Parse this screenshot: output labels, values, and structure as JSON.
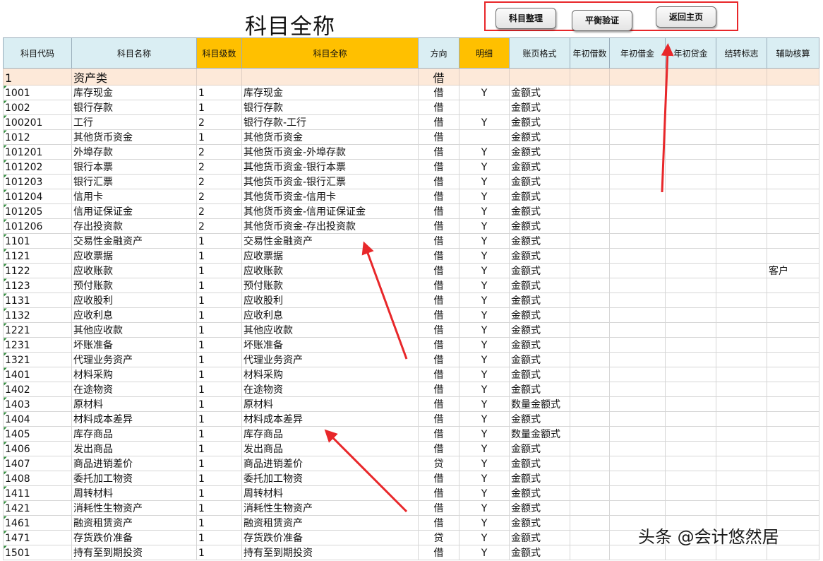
{
  "sheet_title": "科目全称",
  "buttons": [
    "科目整理",
    "平衡验证",
    "返回主页"
  ],
  "columns": [
    "科目代码",
    "科目名称",
    "科目级数",
    "科目全称",
    "方向",
    "明细",
    "账页格式",
    "年初借数",
    "年初借金",
    "年初贷金",
    "结转标志",
    "辅助核算"
  ],
  "group_row": [
    "1",
    "资产类",
    "",
    "",
    "借",
    "",
    "",
    "",
    "",
    "",
    "",
    ""
  ],
  "rows": [
    [
      "1001",
      "库存现金",
      "1",
      "库存现金",
      "借",
      "Y",
      "金额式",
      "",
      "",
      "",
      "",
      ""
    ],
    [
      "1002",
      "银行存款",
      "1",
      "银行存款",
      "借",
      "",
      "金额式",
      "",
      "",
      "",
      "",
      ""
    ],
    [
      "100201",
      "工行",
      "2",
      "银行存款-工行",
      "借",
      "Y",
      "金额式",
      "",
      "",
      "",
      "",
      ""
    ],
    [
      "1012",
      "其他货币资金",
      "1",
      "其他货币资金",
      "借",
      "",
      "金额式",
      "",
      "",
      "",
      "",
      ""
    ],
    [
      "101201",
      "外埠存款",
      "2",
      "其他货币资金-外埠存款",
      "借",
      "Y",
      "金额式",
      "",
      "",
      "",
      "",
      ""
    ],
    [
      "101202",
      "银行本票",
      "2",
      "其他货币资金-银行本票",
      "借",
      "Y",
      "金额式",
      "",
      "",
      "",
      "",
      ""
    ],
    [
      "101203",
      "银行汇票",
      "2",
      "其他货币资金-银行汇票",
      "借",
      "Y",
      "金额式",
      "",
      "",
      "",
      "",
      ""
    ],
    [
      "101204",
      "信用卡",
      "2",
      "其他货币资金-信用卡",
      "借",
      "Y",
      "金额式",
      "",
      "",
      "",
      "",
      ""
    ],
    [
      "101205",
      "信用证保证金",
      "2",
      "其他货币资金-信用证保证金",
      "借",
      "Y",
      "金额式",
      "",
      "",
      "",
      "",
      ""
    ],
    [
      "101206",
      "存出投资款",
      "2",
      "其他货币资金-存出投资款",
      "借",
      "Y",
      "金额式",
      "",
      "",
      "",
      "",
      ""
    ],
    [
      "1101",
      "交易性金融资产",
      "1",
      "交易性金融资产",
      "借",
      "Y",
      "金额式",
      "",
      "",
      "",
      "",
      ""
    ],
    [
      "1121",
      "应收票据",
      "1",
      "应收票据",
      "借",
      "Y",
      "金额式",
      "",
      "",
      "",
      "",
      ""
    ],
    [
      "1122",
      "应收账款",
      "1",
      "应收账款",
      "借",
      "Y",
      "金额式",
      "",
      "",
      "",
      "",
      "客户"
    ],
    [
      "1123",
      "预付账款",
      "1",
      "预付账款",
      "借",
      "Y",
      "金额式",
      "",
      "",
      "",
      "",
      ""
    ],
    [
      "1131",
      "应收股利",
      "1",
      "应收股利",
      "借",
      "Y",
      "金额式",
      "",
      "",
      "",
      "",
      ""
    ],
    [
      "1132",
      "应收利息",
      "1",
      "应收利息",
      "借",
      "Y",
      "金额式",
      "",
      "",
      "",
      "",
      ""
    ],
    [
      "1221",
      "其他应收款",
      "1",
      "其他应收款",
      "借",
      "Y",
      "金额式",
      "",
      "",
      "",
      "",
      ""
    ],
    [
      "1231",
      "坏账准备",
      "1",
      "坏账准备",
      "借",
      "Y",
      "金额式",
      "",
      "",
      "",
      "",
      ""
    ],
    [
      "1321",
      "代理业务资产",
      "1",
      "代理业务资产",
      "借",
      "Y",
      "金额式",
      "",
      "",
      "",
      "",
      ""
    ],
    [
      "1401",
      "材料采购",
      "1",
      "材料采购",
      "借",
      "Y",
      "金额式",
      "",
      "",
      "",
      "",
      ""
    ],
    [
      "1402",
      "在途物资",
      "1",
      "在途物资",
      "借",
      "Y",
      "金额式",
      "",
      "",
      "",
      "",
      ""
    ],
    [
      "1403",
      "原材料",
      "1",
      "原材料",
      "借",
      "Y",
      "数量金额式",
      "",
      "",
      "",
      "",
      ""
    ],
    [
      "1404",
      "材料成本差异",
      "1",
      "材料成本差异",
      "借",
      "Y",
      "金额式",
      "",
      "",
      "",
      "",
      ""
    ],
    [
      "1405",
      "库存商品",
      "1",
      "库存商品",
      "借",
      "Y",
      "数量金额式",
      "",
      "",
      "",
      "",
      ""
    ],
    [
      "1406",
      "发出商品",
      "1",
      "发出商品",
      "借",
      "Y",
      "金额式",
      "",
      "",
      "",
      "",
      ""
    ],
    [
      "1407",
      "商品进销差价",
      "1",
      "商品进销差价",
      "贷",
      "Y",
      "金额式",
      "",
      "",
      "",
      "",
      ""
    ],
    [
      "1408",
      "委托加工物资",
      "1",
      "委托加工物资",
      "借",
      "Y",
      "金额式",
      "",
      "",
      "",
      "",
      ""
    ],
    [
      "1411",
      "周转材料",
      "1",
      "周转材料",
      "借",
      "Y",
      "金额式",
      "",
      "",
      "",
      "",
      ""
    ],
    [
      "1421",
      "消耗性生物资产",
      "1",
      "消耗性生物资产",
      "借",
      "Y",
      "金额式",
      "",
      "",
      "",
      "",
      ""
    ],
    [
      "1461",
      "融资租赁资产",
      "1",
      "融资租赁资产",
      "借",
      "Y",
      "金额式",
      "",
      "",
      "",
      "",
      ""
    ],
    [
      "1471",
      "存货跌价准备",
      "1",
      "存货跌价准备",
      "贷",
      "Y",
      "金额式",
      "",
      "",
      "",
      "",
      ""
    ],
    [
      "1501",
      "持有至到期投资",
      "1",
      "持有至到期投资",
      "借",
      "Y",
      "金额式",
      "",
      "",
      "",
      "",
      ""
    ]
  ],
  "watermark": "头条 @会计悠然居",
  "colors": {
    "header": "#daeef3",
    "header_highlight": "#ffc000",
    "group_row": "#fde9d9",
    "annotation": "#e8272a"
  }
}
